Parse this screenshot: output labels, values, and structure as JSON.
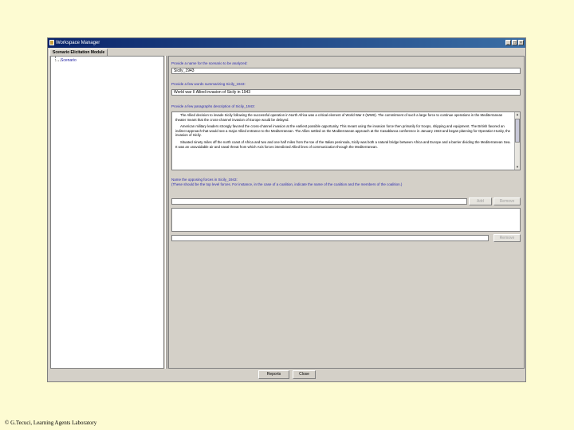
{
  "window": {
    "title": "Workspace Manager",
    "controls": {
      "minimize": "_",
      "maximize": "□",
      "close": "×"
    }
  },
  "tab": {
    "label": "Scenario Elicitation Module"
  },
  "tree": {
    "items": [
      {
        "label": "Scenario"
      }
    ]
  },
  "form": {
    "name_prompt": "Provide a name for the scenario to be analyzed:",
    "name_value": "Sicily_1943",
    "words_prompt": "Provide a few words summarizing Sicily_1943:",
    "words_value": "World war II Allied invasion of Sicily in 1943",
    "paragraph_prompt": "Provide a few paragraphs description of Sicily_1943:",
    "paragraphs": [
      "The Allied decision to invade Sicily following the successful operation in North Africa was a critical element of World War II (WWII). The commitment of such a large force to continue operations in the Mediterranean theater meant that the cross-channel invasion of Europe would be delayed.",
      "American military leaders strongly favored the cross-channel invasion at the earliest possible opportunity. This meant using the invasion force then primarily for troops, shipping and equipment. The British favored an indirect approach that would see a major Allied entrance to the Mediterranean. The Allies settled on the Mediterranean approach at the Casablanca conference in January 1943 and began planning for Operation Husky, the invasion of Sicily.",
      "Situated ninety miles off the north coast of Africa and two and one half miles from the toe of the Italian peninsula, Sicily was both a natural bridge between Africa and Europe and a barrier dividing the Mediterranean Sea. It was an unavoidable air and naval threat from which Axis forces interdicted Allied lines of communication through the Mediterranean."
    ],
    "forces_prompt_line1": "Name the opposing forces in Sicily_1943:",
    "forces_prompt_line2": "(These should be the top level forces. For instance, in the case of a coalition, indicate the name of the coalition and the members of the coalition.)",
    "force_input_value": "",
    "add_label": "Add",
    "remove_label": "Remove",
    "remove2_label": "Remove"
  },
  "footer": {
    "reports_label": "Reports",
    "close_label": "Close"
  },
  "copyright": "© G.Tecuci, Learning Agents Laboratory"
}
